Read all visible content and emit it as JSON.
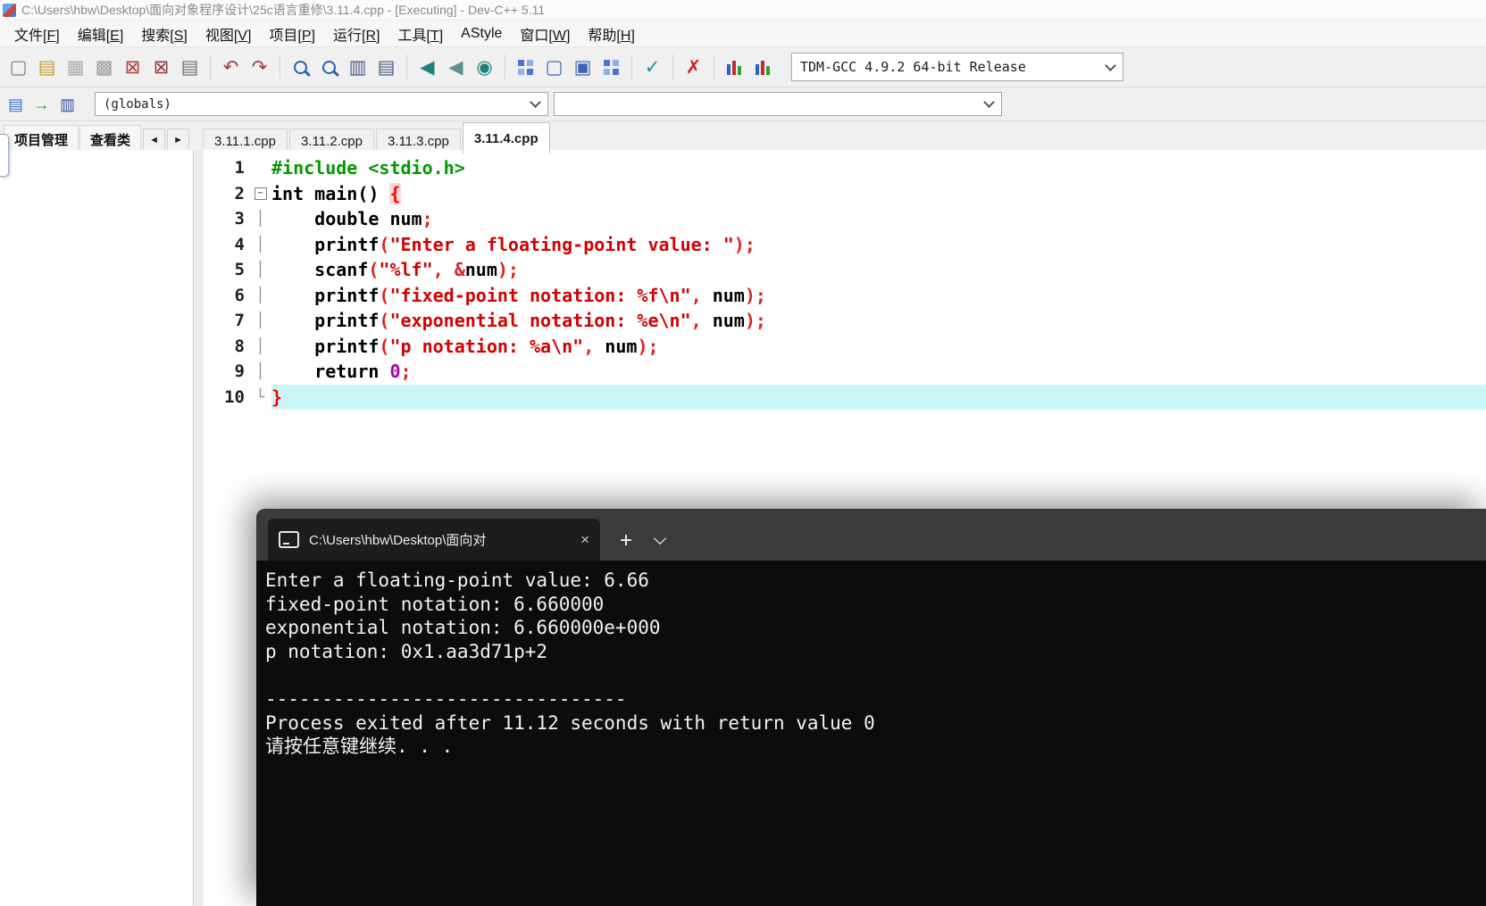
{
  "window": {
    "title": "C:\\Users\\hbw\\Desktop\\面向对象程序设计\\25c语言重修\\3.11.4.cpp - [Executing] - Dev-C++ 5.11"
  },
  "menu": {
    "items": [
      "文件[F]",
      "编辑[E]",
      "搜索[S]",
      "视图[V]",
      "项目[P]",
      "运行[R]",
      "工具[T]",
      "AStyle",
      "窗口[W]",
      "帮助[H]"
    ]
  },
  "toolbar": {
    "compiler": "TDM-GCC 4.9.2 64-bit Release",
    "groups": [
      [
        {
          "name": "new-source-icon",
          "type": "glyph",
          "glyph": "▢",
          "color": "#7a7a7a"
        },
        {
          "name": "open-icon",
          "type": "glyph",
          "glyph": "▤",
          "color": "#c79a2e"
        },
        {
          "name": "save-icon",
          "type": "glyph",
          "glyph": "▦",
          "color": "#ababab"
        },
        {
          "name": "save-all-icon",
          "type": "glyph",
          "glyph": "▩",
          "color": "#9a9a9a"
        },
        {
          "name": "close-icon",
          "type": "glyph",
          "glyph": "⊠",
          "color": "#b23b3b"
        },
        {
          "name": "close-all-icon",
          "type": "glyph",
          "glyph": "⊠",
          "color": "#8f3b3b"
        },
        {
          "name": "print-icon",
          "type": "glyph",
          "glyph": "▤",
          "color": "#6d6d6d"
        }
      ],
      [
        {
          "name": "undo-icon",
          "type": "glyph",
          "glyph": "↶",
          "color": "#a03c3c"
        },
        {
          "name": "redo-icon",
          "type": "glyph",
          "glyph": "↷",
          "color": "#a03c3c"
        }
      ],
      [
        {
          "name": "find-icon",
          "type": "mag"
        },
        {
          "name": "replace-icon",
          "type": "mag"
        },
        {
          "name": "goto-line-icon",
          "type": "glyph",
          "glyph": "▥",
          "color": "#4a5a8a"
        },
        {
          "name": "reformat-icon",
          "type": "glyph",
          "glyph": "▤",
          "color": "#4a5a8a"
        }
      ],
      [
        {
          "name": "back-icon",
          "type": "glyph",
          "glyph": "◀",
          "color": "#1e7f7f"
        },
        {
          "name": "forward-icon",
          "type": "glyph",
          "glyph": "◀",
          "color": "#5f8f8f"
        },
        {
          "name": "pause-icon",
          "type": "glyph",
          "glyph": "◉",
          "color": "#1e7f7f"
        }
      ],
      [
        {
          "name": "compile-icon",
          "type": "grid"
        },
        {
          "name": "run-icon",
          "type": "glyph",
          "glyph": "▢",
          "color": "#3a62b8"
        },
        {
          "name": "rebuild-all-icon",
          "type": "glyph",
          "glyph": "▣",
          "color": "#3a62b8"
        },
        {
          "name": "compile-run-icon",
          "type": "grid"
        }
      ],
      [
        {
          "name": "debug-check-icon",
          "type": "glyph",
          "glyph": "✓",
          "color": "#169393"
        }
      ],
      [
        {
          "name": "abort-icon",
          "type": "glyph",
          "glyph": "✗",
          "color": "#cf2222"
        }
      ],
      [
        {
          "name": "profile-icon",
          "type": "bars"
        },
        {
          "name": "delete-profiling-icon",
          "type": "bars"
        }
      ]
    ]
  },
  "navbar": {
    "icons": [
      {
        "name": "new-file-small-icon",
        "type": "glyph",
        "glyph": "▤",
        "color": "#3a6fd0"
      },
      {
        "name": "goto-definition-icon",
        "type": "glyph",
        "glyph": "→",
        "color": "#1f9d1f"
      },
      {
        "name": "bookmark-icon",
        "type": "glyph",
        "glyph": "▥",
        "color": "#30509f"
      }
    ],
    "globals_value": "(globals)",
    "members_value": ""
  },
  "panel_tabs": {
    "project": "项目管理",
    "classes": "查看类"
  },
  "editor_tabs": {
    "tabs": [
      "3.11.1.cpp",
      "3.11.2.cpp",
      "3.11.3.cpp",
      "3.11.4.cpp"
    ],
    "active_index": 3
  },
  "editor": {
    "lines": [
      {
        "n": "1",
        "fold": "",
        "tokens": [
          {
            "c": "pp",
            "t": "#include <stdio.h>"
          }
        ]
      },
      {
        "n": "2",
        "fold": "box",
        "tokens": [
          {
            "c": "kw",
            "t": "int"
          },
          {
            "c": "pl",
            "t": " main() "
          },
          {
            "c": "bracehl",
            "t": "{"
          }
        ]
      },
      {
        "n": "3",
        "fold": "bar",
        "tokens": [
          {
            "c": "pl",
            "t": "    "
          },
          {
            "c": "kw",
            "t": "double"
          },
          {
            "c": "pl",
            "t": " num"
          },
          {
            "c": "sym",
            "t": ";"
          }
        ]
      },
      {
        "n": "4",
        "fold": "bar",
        "tokens": [
          {
            "c": "pl",
            "t": "    printf"
          },
          {
            "c": "sym",
            "t": "("
          },
          {
            "c": "str",
            "t": "\"Enter a floating-point value: \""
          },
          {
            "c": "sym",
            "t": ");"
          }
        ]
      },
      {
        "n": "5",
        "fold": "bar",
        "tokens": [
          {
            "c": "pl",
            "t": "    scanf"
          },
          {
            "c": "sym",
            "t": "("
          },
          {
            "c": "str",
            "t": "\"%lf\""
          },
          {
            "c": "sym",
            "t": ", &"
          },
          {
            "c": "pl",
            "t": "num"
          },
          {
            "c": "sym",
            "t": ");"
          }
        ]
      },
      {
        "n": "6",
        "fold": "bar",
        "tokens": [
          {
            "c": "pl",
            "t": "    printf"
          },
          {
            "c": "sym",
            "t": "("
          },
          {
            "c": "str",
            "t": "\"fixed-point notation: %f\\n\""
          },
          {
            "c": "sym",
            "t": ","
          },
          {
            "c": "pl",
            "t": " num"
          },
          {
            "c": "sym",
            "t": ");"
          }
        ]
      },
      {
        "n": "7",
        "fold": "bar",
        "tokens": [
          {
            "c": "pl",
            "t": "    printf"
          },
          {
            "c": "sym",
            "t": "("
          },
          {
            "c": "str",
            "t": "\"exponential notation: %e\\n\""
          },
          {
            "c": "sym",
            "t": ","
          },
          {
            "c": "pl",
            "t": " num"
          },
          {
            "c": "sym",
            "t": ");"
          }
        ]
      },
      {
        "n": "8",
        "fold": "bar",
        "tokens": [
          {
            "c": "pl",
            "t": "    printf"
          },
          {
            "c": "sym",
            "t": "("
          },
          {
            "c": "str",
            "t": "\"p notation: %a\\n\""
          },
          {
            "c": "sym",
            "t": ","
          },
          {
            "c": "pl",
            "t": " num"
          },
          {
            "c": "sym",
            "t": ");"
          }
        ]
      },
      {
        "n": "9",
        "fold": "bar",
        "tokens": [
          {
            "c": "pl",
            "t": "    "
          },
          {
            "c": "kw",
            "t": "return"
          },
          {
            "c": "pl",
            "t": " "
          },
          {
            "c": "num",
            "t": "0"
          },
          {
            "c": "sym",
            "t": ";"
          }
        ]
      },
      {
        "n": "10",
        "fold": "end",
        "hl": true,
        "tokens": [
          {
            "c": "brace",
            "t": "}"
          }
        ]
      }
    ]
  },
  "terminal": {
    "tab_title": "C:\\Users\\hbw\\Desktop\\面向对",
    "close_glyph": "×",
    "new_tab_glyph": "+",
    "lines": [
      "Enter a floating-point value: 6.66",
      "fixed-point notation: 6.660000",
      "exponential notation: 6.660000e+000",
      "p notation: 0x1.aa3d71p+2",
      "",
      "--------------------------------",
      "Process exited after 11.12 seconds with return value 0",
      "请按任意键继续. . ."
    ]
  }
}
